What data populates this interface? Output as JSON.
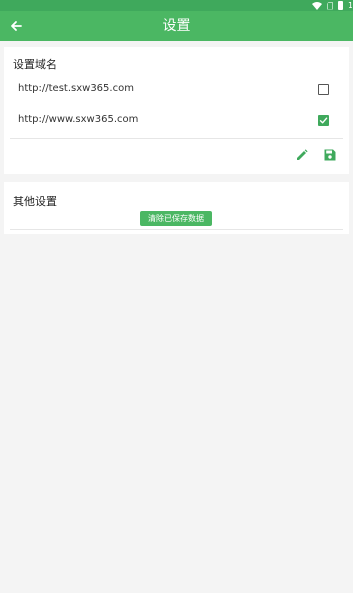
{
  "status_bar": {
    "battery_level": "1"
  },
  "app_bar": {
    "title": "设置"
  },
  "domain_settings": {
    "title": "设置域名",
    "domains": [
      {
        "url": "http://test.sxw365.com",
        "checked": false
      },
      {
        "url": "http://www.sxw365.com",
        "checked": true
      }
    ]
  },
  "other_settings": {
    "title": "其他设置",
    "clear_button_label": "清除已保存数据"
  },
  "colors": {
    "accent": "#4bb763",
    "status_bar": "#3fa95c"
  },
  "icons": [
    "arrow-left-icon",
    "pencil-icon",
    "floppy-disk-icon",
    "wifi-icon",
    "sim-icon",
    "battery-icon"
  ]
}
